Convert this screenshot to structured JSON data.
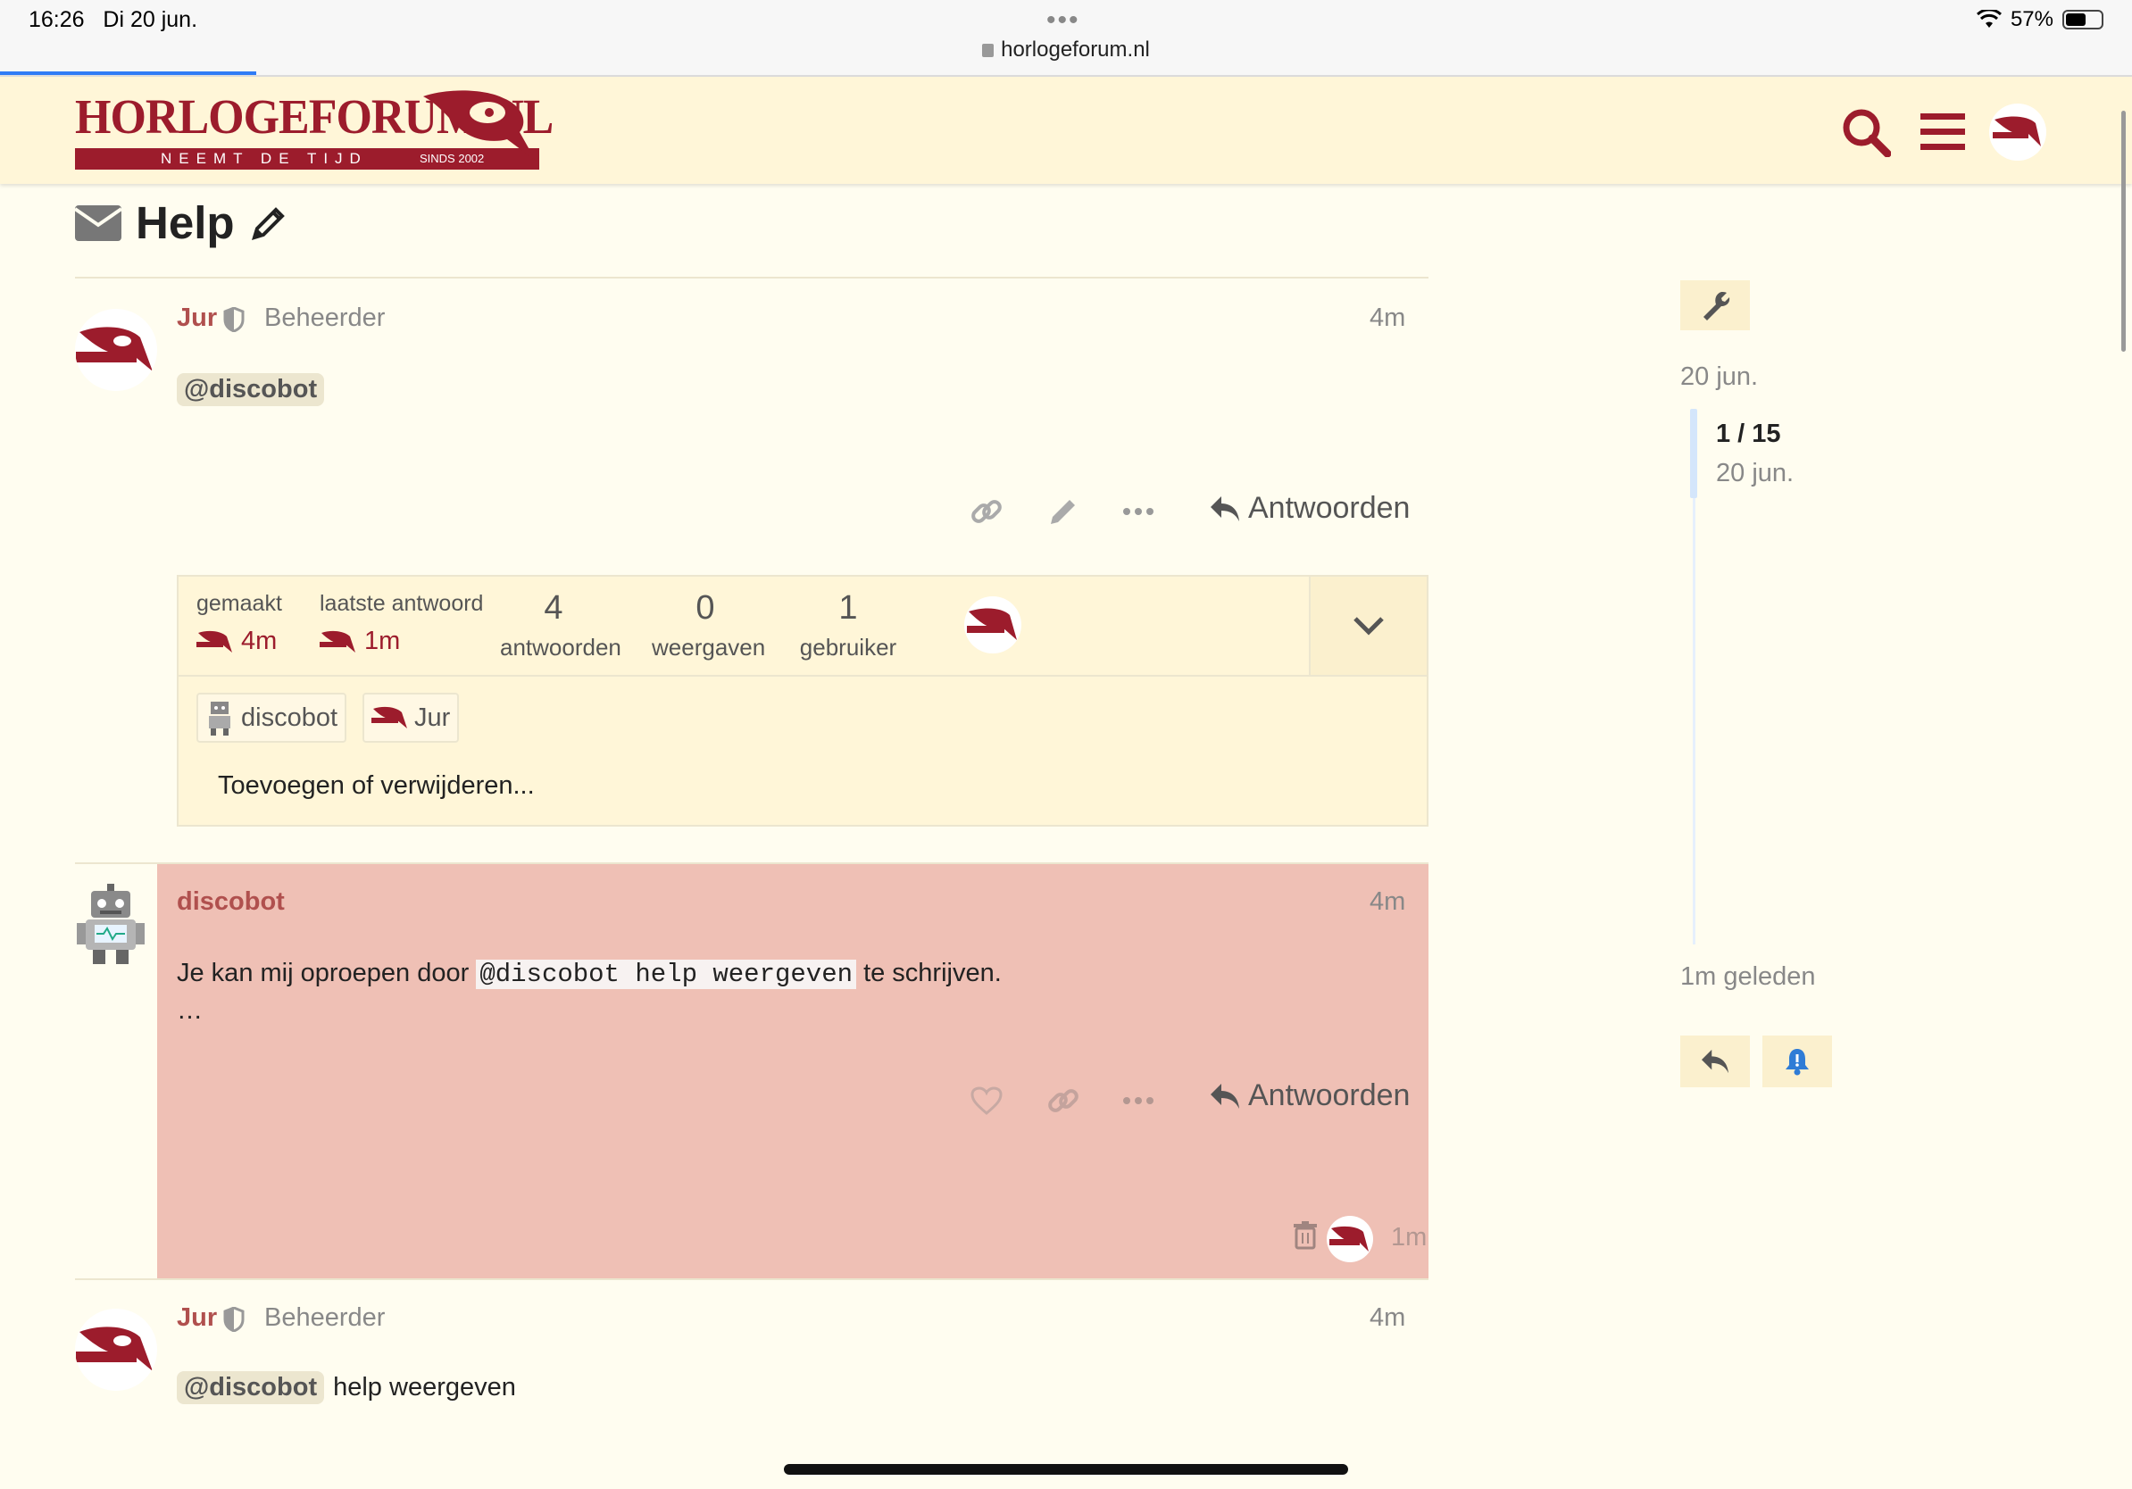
{
  "status_bar": {
    "time": "16:26",
    "date": "Di 20 jun.",
    "dots": "•••",
    "url": "horlogeforum.nl",
    "battery": "57%",
    "battery_level": 0.57
  },
  "header": {
    "logo_title": "HORLOGEFORUM.NL",
    "logo_tagline": "NEEMT DE TIJD",
    "logo_since": "SINDS 2002",
    "brand_color": "#9c1c2c"
  },
  "topic": {
    "title": "Help"
  },
  "posts": [
    {
      "username": "Jur",
      "user_title": "Beheerder",
      "date": "4m",
      "mention": "@discobot",
      "text": "",
      "reply_label": "Antwoorden"
    },
    {
      "username": "discobot",
      "date": "4m",
      "text_before": "Je kan mij oproepen door",
      "code": "@discobot help weergeven",
      "text_after": "te schrijven.",
      "ellipsis": "…",
      "reply_label": "Antwoorden",
      "deleted_time": "1m"
    },
    {
      "username": "Jur",
      "user_title": "Beheerder",
      "date": "4m",
      "mention": "@discobot",
      "text": "help weergeven"
    }
  ],
  "topic_map": {
    "created_label": "gemaakt",
    "created_value": "4m",
    "last_reply_label": "laatste antwoord",
    "last_reply_value": "1m",
    "stats": [
      {
        "value": "4",
        "label": "antwoorden"
      },
      {
        "value": "0",
        "label": "weergaven"
      },
      {
        "value": "1",
        "label": "gebruiker"
      }
    ],
    "participants": [
      "discobot",
      "Jur"
    ],
    "add_remove_label": "Toevoegen of verwijderen..."
  },
  "timeline": {
    "start_date": "20 jun.",
    "position": "1 / 15",
    "position_date": "20 jun.",
    "end_label": "1m geleden"
  }
}
